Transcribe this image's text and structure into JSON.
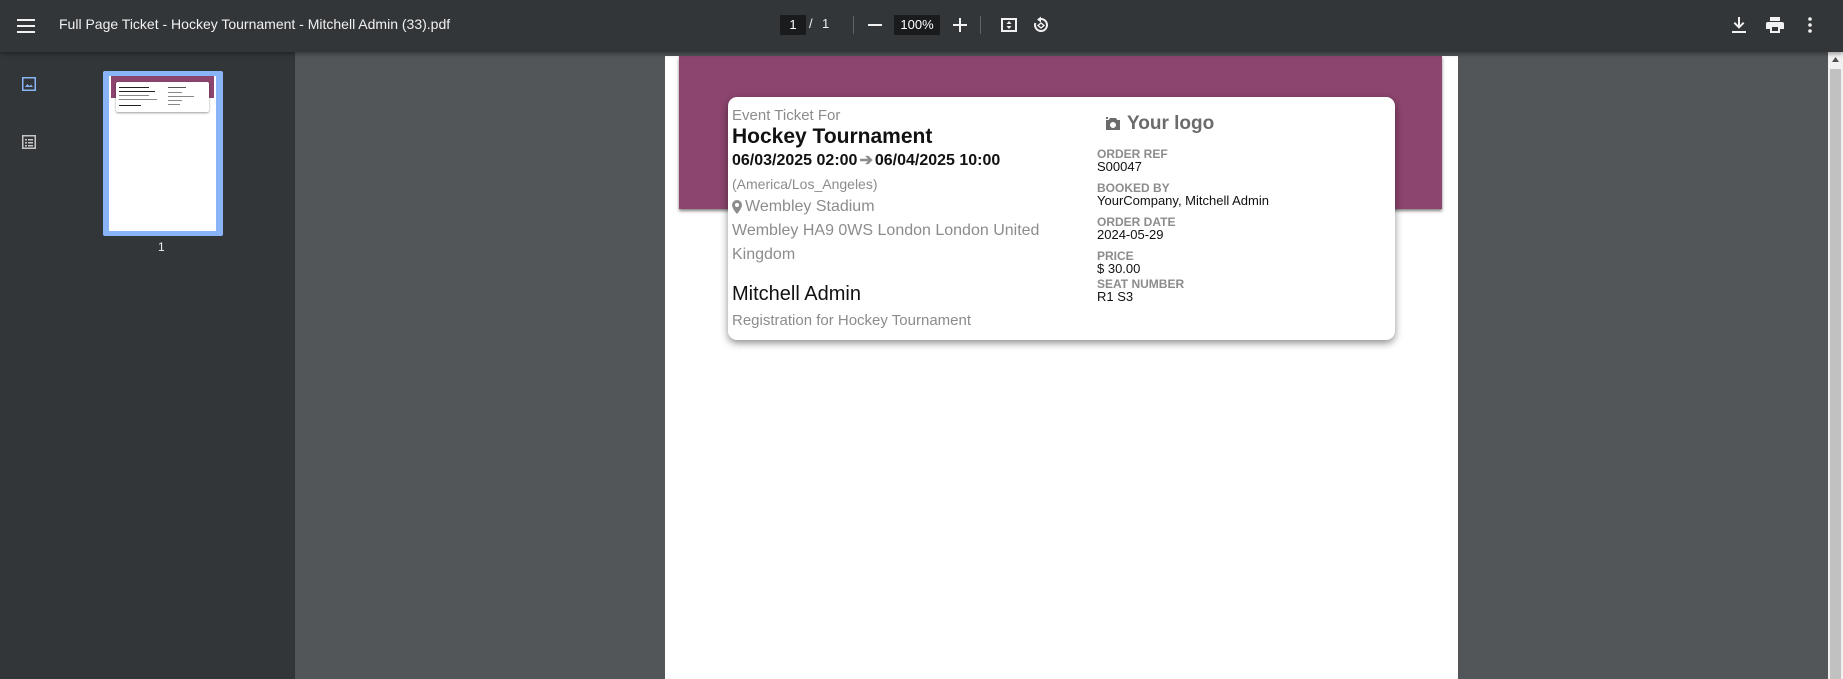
{
  "toolbar": {
    "title": "Full Page Ticket - Hockey Tournament - Mitchell Admin (33).pdf",
    "current_page": "1",
    "page_separator": "/",
    "total_pages": "1",
    "zoom": "100%"
  },
  "sidebar": {
    "thumbnail_page_number": "1"
  },
  "ticket": {
    "label_event_ticket_for": "Event Ticket For",
    "event_name": "Hockey Tournament",
    "date_start": "06/03/2025 02:00",
    "date_end": "06/04/2025 10:00",
    "timezone": "(America/Los_Angeles)",
    "venue": "Wembley Stadium",
    "address": "Wembley HA9 0WS London London United Kingdom",
    "attendee_name": "Mitchell Admin",
    "registration": "Registration for Hockey Tournament",
    "logo_text": "Your logo",
    "order_ref_label": "ORDER REF",
    "order_ref": "S00047",
    "booked_by_label": "BOOKED BY",
    "booked_by": "YourCompany, Mitchell Admin",
    "order_date_label": "ORDER DATE",
    "order_date": "2024-05-29",
    "price_label": "PRICE",
    "price": "$ 30.00",
    "seat_label": "SEAT NUMBER",
    "seat": "R1 S3"
  },
  "colors": {
    "band": "#8c456e",
    "toolbar": "#323639",
    "viewer_bg": "#525659",
    "thumb_highlight": "#8ab4f8"
  },
  "icons": {
    "menu": "menu-icon",
    "zoom_out": "minus-icon",
    "zoom_in": "plus-icon",
    "fit": "fit-page-icon",
    "rotate": "rotate-icon",
    "download": "download-icon",
    "print": "print-icon",
    "more": "more-vertical-icon",
    "thumbnails": "thumbnails-icon",
    "outline": "outline-icon",
    "venue": "map-marker-icon",
    "logo": "camera-icon"
  }
}
